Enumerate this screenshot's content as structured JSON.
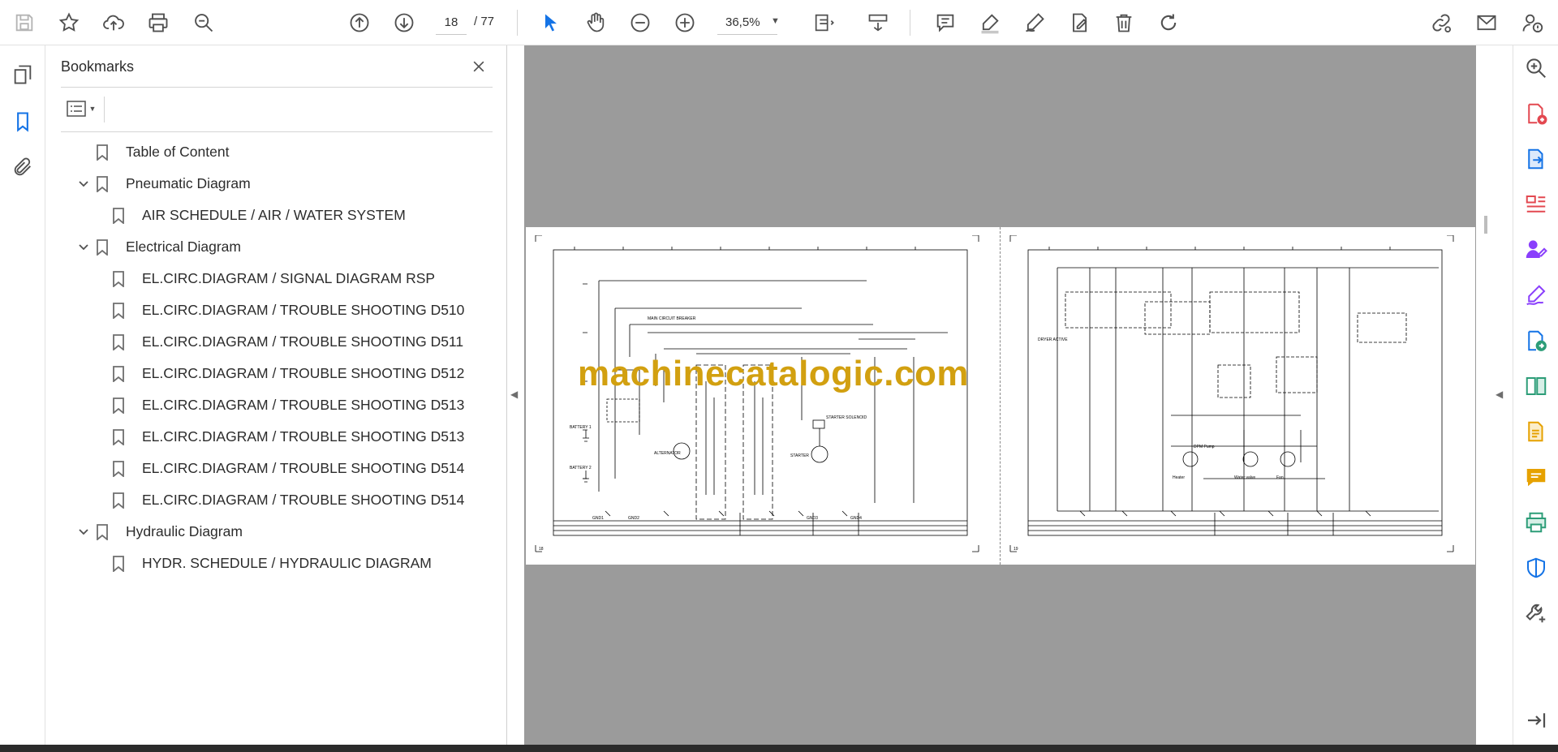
{
  "toolbar": {
    "page_current": "18",
    "page_total": "/ 77",
    "zoom_value": "36,5%"
  },
  "bookmarks_panel": {
    "title": "Bookmarks",
    "items": [
      {
        "label": "Table of Content",
        "level": 0,
        "expandable": false
      },
      {
        "label": "Pneumatic Diagram",
        "level": 0,
        "expandable": true
      },
      {
        "label": "AIR SCHEDULE / AIR / WATER SYSTEM",
        "level": 1,
        "expandable": false
      },
      {
        "label": "Electrical Diagram",
        "level": 0,
        "expandable": true
      },
      {
        "label": "EL.CIRC.DIAGRAM / SIGNAL DIAGRAM RSP",
        "level": 1,
        "expandable": false
      },
      {
        "label": "EL.CIRC.DIAGRAM / TROUBLE SHOOTING D510",
        "level": 1,
        "expandable": false
      },
      {
        "label": "EL.CIRC.DIAGRAM / TROUBLE SHOOTING D511",
        "level": 1,
        "expandable": false
      },
      {
        "label": "EL.CIRC.DIAGRAM / TROUBLE SHOOTING D512",
        "level": 1,
        "expandable": false
      },
      {
        "label": "EL.CIRC.DIAGRAM / TROUBLE SHOOTING D513",
        "level": 1,
        "expandable": false
      },
      {
        "label": "EL.CIRC.DIAGRAM / TROUBLE SHOOTING D513",
        "level": 1,
        "expandable": false
      },
      {
        "label": "EL.CIRC.DIAGRAM / TROUBLE SHOOTING D514",
        "level": 1,
        "expandable": false
      },
      {
        "label": "EL.CIRC.DIAGRAM / TROUBLE SHOOTING D514",
        "level": 1,
        "expandable": false
      },
      {
        "label": "Hydraulic Diagram",
        "level": 0,
        "expandable": true
      },
      {
        "label": "HYDR. SCHEDULE / HYDRAULIC DIAGRAM",
        "level": 1,
        "expandable": false
      }
    ]
  },
  "document": {
    "watermark": "machinecatalogic.com",
    "left_page_number": "18",
    "right_page_number": "19",
    "left_page": {
      "labels": [
        "MAIN CIRCUIT BREAKER",
        "BATTERY 1",
        "BATTERY 2",
        "ALTERNATOR",
        "STARTER",
        "STARTER SOLENOID",
        "GND1",
        "GND2",
        "GND3",
        "GND4"
      ]
    },
    "right_page": {
      "labels": [
        "DRYER ACTIVE",
        "Water valve",
        "Fan",
        "Heater",
        "DPM Pump"
      ]
    }
  },
  "colors": {
    "accent": "#1473e6",
    "watermark": "#d2a010",
    "canvas": "#9b9b9b",
    "rail_purple": "#8a3ffc",
    "rail_red": "#e34850",
    "rail_green": "#2d9d78",
    "rail_yellow": "#e6a100",
    "rail_blue": "#1473e6"
  }
}
